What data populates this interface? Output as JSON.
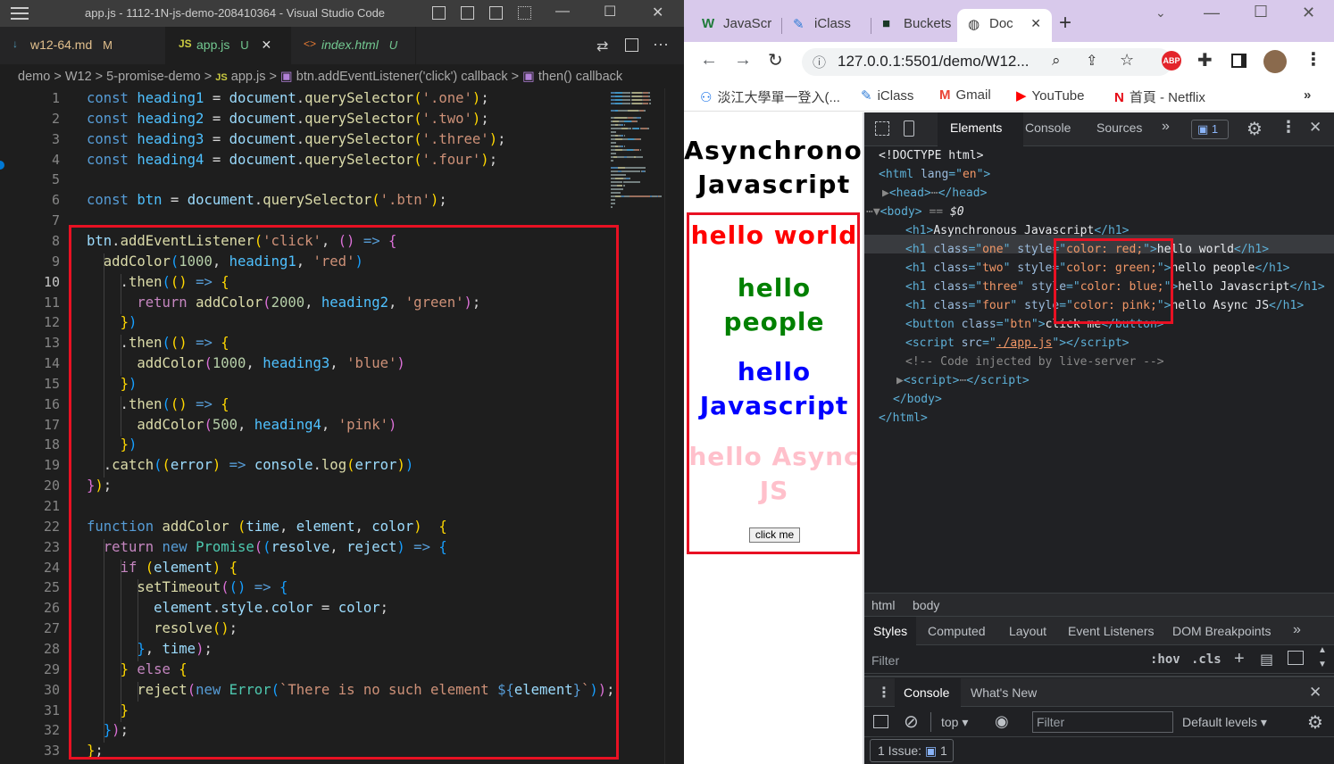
{
  "vscode": {
    "window_title": "app.js - 1112-1N-js-demo-208410364 - Visual Studio Code",
    "tabs": [
      {
        "label": "w12-64.md",
        "status": "M",
        "icon": "↓"
      },
      {
        "label": "app.js",
        "status": "U",
        "icon": "JS",
        "close": "✕"
      },
      {
        "label": "index.html",
        "status": "U",
        "icon": "<>"
      }
    ],
    "breadcrumb": [
      "demo",
      ">",
      "W12",
      ">",
      "5-promise-demo",
      ">",
      "JS",
      "app.js",
      ">",
      "btn.addEventListener('click') callback",
      ">",
      "then() callback"
    ],
    "current_line": 10,
    "line_numbers": [
      "1",
      "2",
      "3",
      "4",
      "5",
      "6",
      "7",
      "8",
      "9",
      "10",
      "11",
      "12",
      "13",
      "14",
      "15",
      "16",
      "17",
      "18",
      "19",
      "20",
      "21",
      "22",
      "23",
      "24",
      "25",
      "26",
      "27",
      "28",
      "29",
      "30",
      "31",
      "32",
      "33"
    ]
  },
  "chrome": {
    "tabs": [
      {
        "label": "JavaScr",
        "icon": "W"
      },
      {
        "label": "iClass",
        "icon": "✎"
      },
      {
        "label": "Buckets",
        "icon": "■"
      },
      {
        "label": "Doc",
        "icon": "◍",
        "close": "✕"
      }
    ],
    "new_tab": "+",
    "url": "127.0.0.1:5501/demo/W12...",
    "bookmarks": [
      {
        "label": "淡江大學單一登入(...",
        "icon": "⚇"
      },
      {
        "label": "iClass",
        "icon": "✎"
      },
      {
        "label": "Gmail",
        "icon": "M"
      },
      {
        "label": "YouTube",
        "icon": "▶"
      },
      {
        "label": "首頁 - Netflix",
        "icon": "N"
      }
    ],
    "bookmarks_more": "»",
    "page": {
      "title": "Asynchronous Javascript",
      "headings": [
        {
          "text": "hello world",
          "color": "#ff0000"
        },
        {
          "text": "hello people",
          "color": "#008000"
        },
        {
          "text": "hello Javascript",
          "color": "#0000ff"
        },
        {
          "text": "hello Async JS",
          "color": "#ffc0cb"
        }
      ],
      "button": "click me"
    }
  },
  "devtools": {
    "top_tabs": [
      "Elements",
      "Console",
      "Sources",
      "»"
    ],
    "issues_badge": "1",
    "dom_crumbs": [
      "html",
      "body"
    ],
    "styles_tabs": [
      "Styles",
      "Computed",
      "Layout",
      "Event Listeners",
      "DOM Breakpoints",
      "»"
    ],
    "filter_placeholder": "Filter",
    "hov": ":hov",
    "cls": ".cls",
    "drawer_tabs": [
      "Console",
      "What's New"
    ],
    "context": "top",
    "console_filter": "Filter",
    "levels": "Default levels",
    "issue_text": "1 Issue:",
    "issue_count": "1"
  }
}
